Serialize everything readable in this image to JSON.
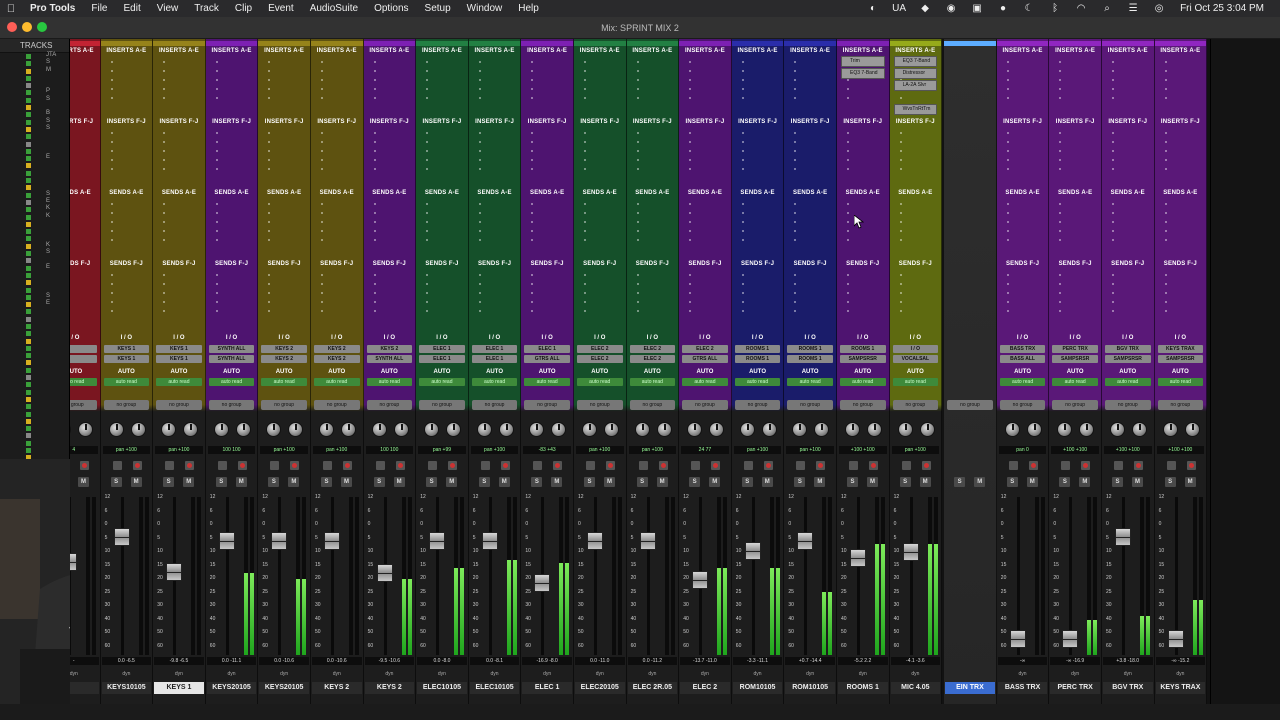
{
  "menubar": {
    "apple": "",
    "items": [
      "Pro Tools",
      "File",
      "Edit",
      "View",
      "Track",
      "Clip",
      "Event",
      "AudioSuite",
      "Options",
      "Setup",
      "Window",
      "Help"
    ],
    "input_source": "UA",
    "datetime": "Fri Oct 25  3:04 PM"
  },
  "window": {
    "title": "Mix: SPRINT MIX 2"
  },
  "tracks_panel": {
    "header": "TRACKS",
    "rows": [
      "JTA",
      "S",
      "M",
      "",
      "",
      "P",
      "S",
      "",
      "B",
      "S",
      "S",
      "",
      "",
      "",
      "E",
      "",
      "",
      "",
      "",
      "S",
      "E",
      "K",
      "K",
      "",
      "",
      "",
      "K",
      "S",
      "",
      "E",
      "",
      "",
      "",
      "S",
      "E",
      "",
      "",
      "",
      "",
      "",
      "",
      "",
      "",
      "",
      "",
      "",
      "",
      "",
      "",
      "",
      "",
      "",
      "",
      "",
      "",
      "",
      "",
      ""
    ]
  },
  "labels": {
    "inserts_ae": "INSERTS A-E",
    "inserts_fj": "INSERTS F-J",
    "sends_ae": "SENDS A-E",
    "sends_fj": "SENDS F-J",
    "io": "I / O",
    "auto": "AUTO",
    "auto_read": "auto read",
    "no_group": "no group",
    "dyn": "dyn"
  },
  "colors": {
    "red": "#7a1620",
    "olive": "#5e5210",
    "purple": "#4e1470",
    "green": "#15502a",
    "blue": "#1a1c6a",
    "lime": "#5e6a10",
    "grey": "#3a3a3a",
    "magenta": "#5a1878"
  },
  "strips": [
    {
      "name": "",
      "color": "red",
      "input": "",
      "output": "",
      "pan": "4",
      "vol": "-",
      "fader": 0.6,
      "meter": 0.0,
      "partial": true
    },
    {
      "name": "KEYS10105",
      "color": "olive",
      "input": "KEYS 1",
      "output": "KEYS 1",
      "pan": "pan  +100",
      "vol": "0.0  -6.5",
      "fader": 0.78,
      "meter": 0.0
    },
    {
      "name": "KEYS 1",
      "color": "olive",
      "input": "KEYS 1",
      "output": "KEYS 1",
      "pan": "pan  +100",
      "vol": "-9.8  -6.5",
      "fader": 0.53,
      "meter": 0.0,
      "selected": true
    },
    {
      "name": "KEYS20105",
      "color": "purple",
      "input": "SYNTH ALL",
      "output": "SYNTH ALL",
      "pan": "100  100",
      "vol": "0.0  -11.1",
      "fader": 0.75,
      "meter": 0.52
    },
    {
      "name": "KEYS20105",
      "color": "olive",
      "input": "KEYS 2",
      "output": "KEYS 2",
      "pan": "pan  +100",
      "vol": "0.0  -10.6",
      "fader": 0.75,
      "meter": 0.48
    },
    {
      "name": "KEYS 2",
      "color": "olive",
      "input": "KEYS 2",
      "output": "KEYS 2",
      "pan": "pan  +100",
      "vol": "0.0  -10.6",
      "fader": 0.75,
      "meter": 0.0
    },
    {
      "name": "KEYS 2",
      "color": "purple",
      "input": "KEYS 2",
      "output": "SYNTH ALL",
      "pan": "100  100",
      "vol": "-9.5  -10.6",
      "fader": 0.52,
      "meter": 0.48
    },
    {
      "name": "ELEC10105",
      "color": "green",
      "input": "ELEC 1",
      "output": "ELEC 1",
      "pan": "pan  +99",
      "vol": "0.0  -8.0",
      "fader": 0.75,
      "meter": 0.55
    },
    {
      "name": "ELEC10105",
      "color": "green",
      "input": "ELEC 1",
      "output": "ELEC 1",
      "pan": "pan  +100",
      "vol": "0.0  -8.1",
      "fader": 0.75,
      "meter": 0.6
    },
    {
      "name": "ELEC 1",
      "color": "purple",
      "input": "ELEC 1",
      "output": "GTRS ALL",
      "pan": "-83  +43",
      "vol": "-16.9  -8.0",
      "fader": 0.45,
      "meter": 0.58
    },
    {
      "name": "ELEC20105",
      "color": "green",
      "input": "ELEC 2",
      "output": "ELEC 2",
      "pan": "pan  +100",
      "vol": "0.0  -11.0",
      "fader": 0.75,
      "meter": 0.0
    },
    {
      "name": "ELEC 2R.05",
      "color": "green",
      "input": "ELEC 2",
      "output": "ELEC 2",
      "pan": "pan  +100",
      "vol": "0.0  -11.2",
      "fader": 0.75,
      "meter": 0.0
    },
    {
      "name": "ELEC 2",
      "color": "purple",
      "input": "ELEC 2",
      "output": "GTRS ALL",
      "pan": "24  77",
      "vol": "-13.7  -11.0",
      "fader": 0.47,
      "meter": 0.55
    },
    {
      "name": "ROM10105",
      "color": "blue",
      "input": "ROOMS 1",
      "output": "ROOMS 1",
      "pan": "pan  +100",
      "vol": "-3.3  -11.1",
      "fader": 0.68,
      "meter": 0.55
    },
    {
      "name": "ROM10105",
      "color": "blue",
      "input": "ROOMS 1",
      "output": "ROOMS 1",
      "pan": "pan  +100",
      "vol": "+0.7  -14.4",
      "fader": 0.75,
      "meter": 0.4
    },
    {
      "name": "ROOMS 1",
      "color": "purple",
      "input": "ROOMS 1",
      "output": "SAMPSRSR",
      "pan": "+100  +100",
      "vol": "-5.2  2.2",
      "fader": 0.63,
      "meter": 0.7,
      "inserts": [
        "Trim",
        "EQ3 7-Band"
      ]
    },
    {
      "name": "MIC 4.05",
      "color": "lime",
      "input": "I / O",
      "output": "VOCALSAL",
      "pan": "pan  +100",
      "vol": "-4.1  -3.6",
      "fader": 0.67,
      "meter": 0.7,
      "inserts": [
        "EQ3 7-Band",
        "Distressor",
        "LA-2A Slvr",
        "",
        "WvsTnRtTm"
      ]
    },
    {
      "name": "EIN TRX",
      "color": "grey",
      "input": "",
      "output": "",
      "pan": "",
      "vol": "",
      "fader": 0.0,
      "meter": 0.0,
      "empty": true
    },
    {
      "name": "BASS TRX",
      "color": "magenta",
      "input": "BASS TRX",
      "output": "BASS ALL",
      "pan": "pan  0",
      "vol": "-∞",
      "fader": 0.05,
      "meter": 0.0
    },
    {
      "name": "PERC TRX",
      "color": "magenta",
      "input": "PERC TRX",
      "output": "SAMPSRSR",
      "pan": "+100  +100",
      "vol": "-∞  -16.9",
      "fader": 0.05,
      "meter": 0.22
    },
    {
      "name": "BGV TRX",
      "color": "magenta",
      "input": "BGV TRX",
      "output": "SAMPSRSR",
      "pan": "+100  +100",
      "vol": "+3.8  -18.0",
      "fader": 0.78,
      "meter": 0.25
    },
    {
      "name": "KEYS TRAX",
      "color": "magenta",
      "input": "KEYS TRAX",
      "output": "SAMPSRSR",
      "pan": "+100  +100",
      "vol": "-∞  -15.2",
      "fader": 0.05,
      "meter": 0.35
    }
  ],
  "fader_scale": [
    "12",
    "6",
    "0",
    "5",
    "10",
    "15",
    "20",
    "25",
    "30",
    "40",
    "50",
    "60"
  ]
}
